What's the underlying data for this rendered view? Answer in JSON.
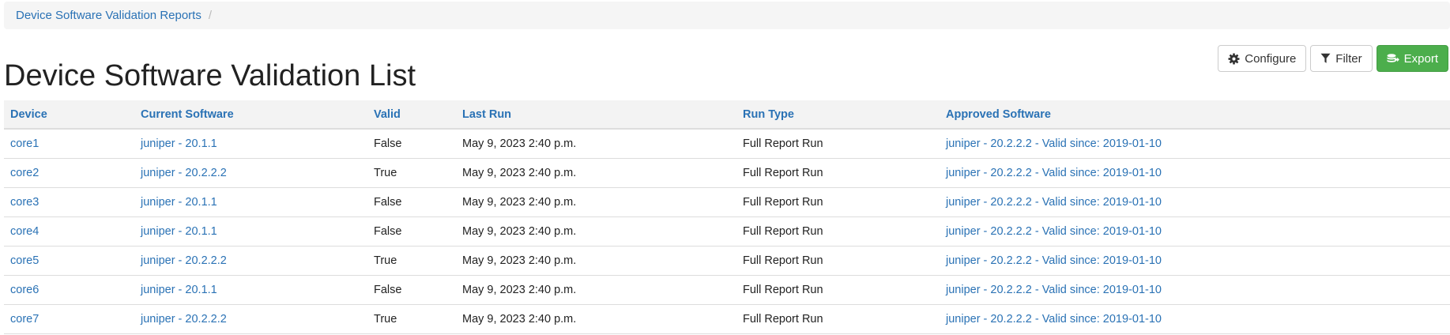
{
  "breadcrumb": {
    "items": [
      "Device Software Validation Reports"
    ],
    "separator": "/"
  },
  "page": {
    "title": "Device Software Validation List"
  },
  "toolbar": {
    "configure_label": "Configure",
    "filter_label": "Filter",
    "export_label": "Export",
    "configure_icon": "gear-icon",
    "filter_icon": "filter-icon",
    "export_icon": "export-icon",
    "export_color": "#4cae4c"
  },
  "colors": {
    "link": "#2a72b5",
    "header_bg": "#f3f3f3",
    "breadcrumb_bg": "#f5f5f5"
  },
  "table": {
    "columns": [
      "Device",
      "Current Software",
      "Valid",
      "Last Run",
      "Run Type",
      "Approved Software"
    ],
    "rows": [
      [
        "core1",
        "juniper - 20.1.1",
        "False",
        "May 9, 2023 2:40 p.m.",
        "Full Report Run",
        "juniper - 20.2.2.2 - Valid since: 2019-01-10"
      ],
      [
        "core2",
        "juniper - 20.2.2.2",
        "True",
        "May 9, 2023 2:40 p.m.",
        "Full Report Run",
        "juniper - 20.2.2.2 - Valid since: 2019-01-10"
      ],
      [
        "core3",
        "juniper - 20.1.1",
        "False",
        "May 9, 2023 2:40 p.m.",
        "Full Report Run",
        "juniper - 20.2.2.2 - Valid since: 2019-01-10"
      ],
      [
        "core4",
        "juniper - 20.1.1",
        "False",
        "May 9, 2023 2:40 p.m.",
        "Full Report Run",
        "juniper - 20.2.2.2 - Valid since: 2019-01-10"
      ],
      [
        "core5",
        "juniper - 20.2.2.2",
        "True",
        "May 9, 2023 2:40 p.m.",
        "Full Report Run",
        "juniper - 20.2.2.2 - Valid since: 2019-01-10"
      ],
      [
        "core6",
        "juniper - 20.1.1",
        "False",
        "May 9, 2023 2:40 p.m.",
        "Full Report Run",
        "juniper - 20.2.2.2 - Valid since: 2019-01-10"
      ],
      [
        "core7",
        "juniper - 20.2.2.2",
        "True",
        "May 9, 2023 2:40 p.m.",
        "Full Report Run",
        "juniper - 20.2.2.2 - Valid since: 2019-01-10"
      ]
    ]
  }
}
